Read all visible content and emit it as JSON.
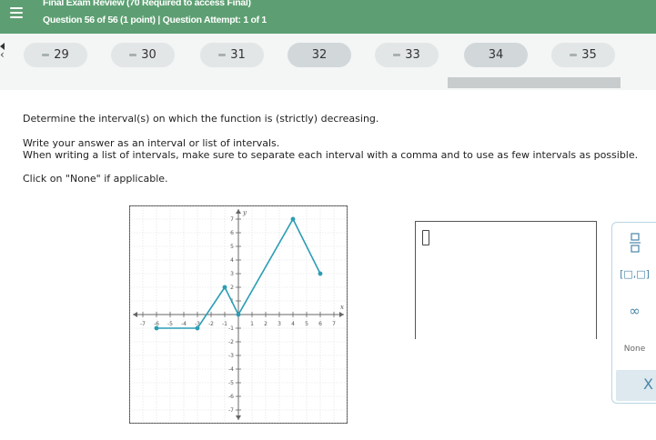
{
  "header": {
    "title": "Final Exam Review (70 Required to access Final)",
    "subtitle": "Question 56 of 56 (1 point)  |  Question Attempt: 1 of 1"
  },
  "nav": {
    "questions": [
      {
        "label": "29",
        "flag": true
      },
      {
        "label": "30",
        "flag": true
      },
      {
        "label": "31",
        "flag": true
      },
      {
        "label": "32",
        "flag": false
      },
      {
        "label": "33",
        "flag": true
      },
      {
        "label": "34",
        "flag": false
      },
      {
        "label": "35",
        "flag": true
      }
    ]
  },
  "question": {
    "prompt": "Determine the interval(s) on which the function is (strictly) decreasing.",
    "instruction1": "Write your answer as an interval or list of intervals.",
    "instruction2": "When writing a list of intervals, make sure to separate each interval with a comma and to use as few intervals as possible.",
    "instruction3": "Click on \"None\" if applicable."
  },
  "graph": {
    "x_axis_label": "x",
    "y_axis_label": "y",
    "x_tick_labels": [
      "-7",
      "-6",
      "-5",
      "-4",
      "-3",
      "-2",
      "-1",
      "1",
      "2",
      "3",
      "4",
      "5",
      "6",
      "7"
    ],
    "y_tick_labels": [
      "7",
      "6",
      "5",
      "4",
      "3",
      "2",
      "1",
      "-1",
      "-2",
      "-3",
      "-4",
      "-5",
      "-6",
      "-7"
    ],
    "line_color": "#2a9db5",
    "points": [
      {
        "x": -6,
        "y": -1
      },
      {
        "x": -3,
        "y": -1
      },
      {
        "x": -1,
        "y": 2
      },
      {
        "x": 0,
        "y": 0
      },
      {
        "x": 4,
        "y": 7
      },
      {
        "x": 6,
        "y": 3
      }
    ],
    "closed_points": [
      {
        "x": -6,
        "y": -1
      },
      {
        "x": -3,
        "y": -1
      },
      {
        "x": -1,
        "y": 2
      },
      {
        "x": 0,
        "y": 0
      },
      {
        "x": 4,
        "y": 7
      },
      {
        "x": 6,
        "y": 3
      }
    ]
  },
  "palette": {
    "none_label": "None",
    "close_symbol": "X",
    "infinity_symbol": "∞",
    "interval_symbol": "[□,□]"
  },
  "colors": {
    "header_bg": "#5d9f72",
    "accent": "#4a86a8"
  }
}
